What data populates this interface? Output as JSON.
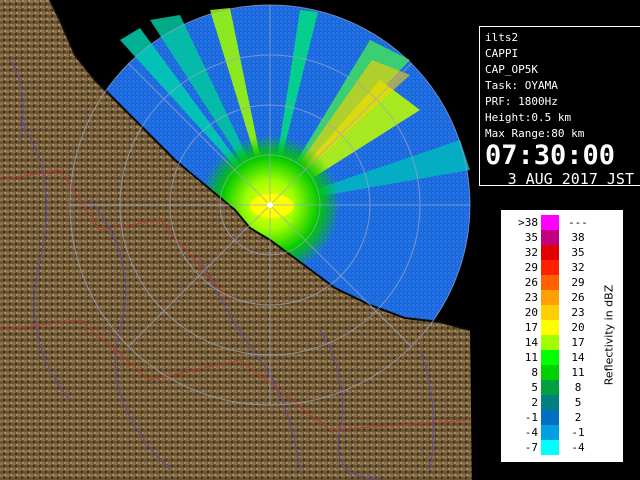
{
  "info": {
    "radar_name": "ilts2",
    "product": "CAPPI",
    "product_code": "CAP_OP5K",
    "task": "Task: OYAMA",
    "prf": "PRF: 1800Hz",
    "height": "Height:0.5 km",
    "max_range": "Max Range:80 km",
    "time": "07:30:00",
    "date": "3 AUG 2017 JST"
  },
  "legend": {
    "unit_label": "Reflectivity in dBZ",
    "rows": [
      {
        "lo": ">38",
        "hi": "---",
        "color": "#ff00ff"
      },
      {
        "lo": "35",
        "hi": "38",
        "color": "#c00080"
      },
      {
        "lo": "32",
        "hi": "35",
        "color": "#e00000"
      },
      {
        "lo": "29",
        "hi": "32",
        "color": "#ff2000"
      },
      {
        "lo": "26",
        "hi": "29",
        "color": "#ff6000"
      },
      {
        "lo": "23",
        "hi": "26",
        "color": "#ffa000"
      },
      {
        "lo": "20",
        "hi": "23",
        "color": "#ffd000"
      },
      {
        "lo": "17",
        "hi": "20",
        "color": "#ffff00"
      },
      {
        "lo": "14",
        "hi": "17",
        "color": "#a0ff00"
      },
      {
        "lo": "11",
        "hi": "14",
        "color": "#00ff00"
      },
      {
        "lo": "8",
        "hi": "11",
        "color": "#00d000"
      },
      {
        "lo": "5",
        "hi": "8",
        "color": "#00a040"
      },
      {
        "lo": "2",
        "hi": "5",
        "color": "#008080"
      },
      {
        "lo": "-1",
        "hi": "2",
        "color": "#0070c0"
      },
      {
        "lo": "-4",
        "hi": "-1",
        "color": "#00a0e0"
      },
      {
        "lo": "-7",
        "hi": "-4",
        "color": "#00ffff"
      }
    ]
  },
  "colors": {
    "terrain": "#6b5535",
    "terrain_light": "#a88a5c",
    "sea_echo": "#1e64dc",
    "range_ring": "#9aa6c8"
  }
}
